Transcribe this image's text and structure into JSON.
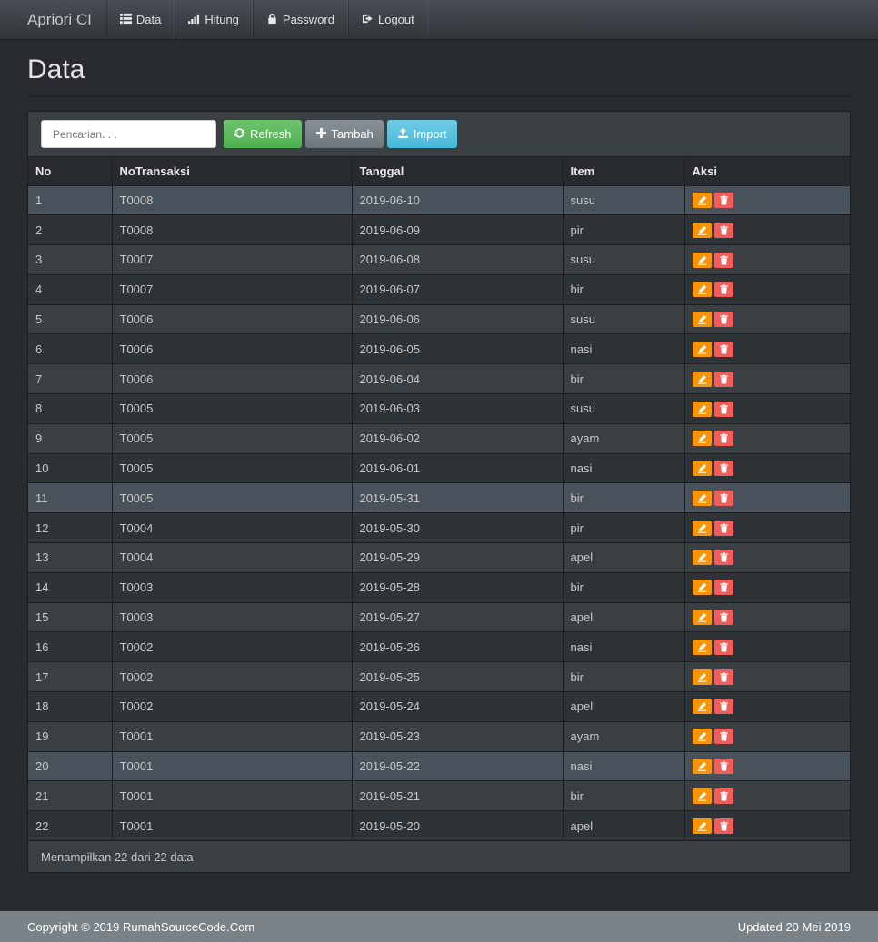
{
  "navbar": {
    "brand": "Apriori CI",
    "items": [
      {
        "label": "Data",
        "icon": "list-icon"
      },
      {
        "label": "Hitung",
        "icon": "signal-icon"
      },
      {
        "label": "Password",
        "icon": "lock-icon"
      },
      {
        "label": "Logout",
        "icon": "logout-icon"
      }
    ]
  },
  "page": {
    "title": "Data"
  },
  "toolbar": {
    "search_placeholder": "Pencarian. . .",
    "refresh_label": "Refresh",
    "add_label": "Tambah",
    "import_label": "Import"
  },
  "table": {
    "columns": [
      "No",
      "NoTransaksi",
      "Tanggal",
      "Item",
      "Aksi"
    ],
    "rows": [
      {
        "no": "1",
        "trx": "T0008",
        "date": "2019-06-10",
        "item": "susu"
      },
      {
        "no": "2",
        "trx": "T0008",
        "date": "2019-06-09",
        "item": "pir"
      },
      {
        "no": "3",
        "trx": "T0007",
        "date": "2019-06-08",
        "item": "susu"
      },
      {
        "no": "4",
        "trx": "T0007",
        "date": "2019-06-07",
        "item": "bir"
      },
      {
        "no": "5",
        "trx": "T0006",
        "date": "2019-06-06",
        "item": "susu"
      },
      {
        "no": "6",
        "trx": "T0006",
        "date": "2019-06-05",
        "item": "nasi"
      },
      {
        "no": "7",
        "trx": "T0006",
        "date": "2019-06-04",
        "item": "bir"
      },
      {
        "no": "8",
        "trx": "T0005",
        "date": "2019-06-03",
        "item": "susu"
      },
      {
        "no": "9",
        "trx": "T0005",
        "date": "2019-06-02",
        "item": "ayam"
      },
      {
        "no": "10",
        "trx": "T0005",
        "date": "2019-06-01",
        "item": "nasi"
      },
      {
        "no": "11",
        "trx": "T0005",
        "date": "2019-05-31",
        "item": "bir"
      },
      {
        "no": "12",
        "trx": "T0004",
        "date": "2019-05-30",
        "item": "pir"
      },
      {
        "no": "13",
        "trx": "T0004",
        "date": "2019-05-29",
        "item": "apel"
      },
      {
        "no": "14",
        "trx": "T0003",
        "date": "2019-05-28",
        "item": "bir"
      },
      {
        "no": "15",
        "trx": "T0003",
        "date": "2019-05-27",
        "item": "apel"
      },
      {
        "no": "16",
        "trx": "T0002",
        "date": "2019-05-26",
        "item": "nasi"
      },
      {
        "no": "17",
        "trx": "T0002",
        "date": "2019-05-25",
        "item": "bir"
      },
      {
        "no": "18",
        "trx": "T0002",
        "date": "2019-05-24",
        "item": "apel"
      },
      {
        "no": "19",
        "trx": "T0001",
        "date": "2019-05-23",
        "item": "ayam"
      },
      {
        "no": "20",
        "trx": "T0001",
        "date": "2019-05-22",
        "item": "nasi"
      },
      {
        "no": "21",
        "trx": "T0001",
        "date": "2019-05-21",
        "item": "bir"
      },
      {
        "no": "22",
        "trx": "T0001",
        "date": "2019-05-20",
        "item": "apel"
      }
    ],
    "highlighted_rows": [
      1,
      11,
      20
    ],
    "edit_icon": "edit-icon",
    "delete_icon": "trash-icon"
  },
  "panel_footer": {
    "summary": "Menampilkan 22 dari 22 data"
  },
  "footer": {
    "copyright": "Copyright © 2019 RumahSourceCode.Com",
    "updated": "Updated 20 Mei 2019"
  },
  "colors": {
    "background": "#272b30",
    "navbar": "#3a3f44",
    "success": "#5cb85c",
    "info": "#5bc0de",
    "warning": "#f89406",
    "danger": "#ee5f5b",
    "footer": "#7a8288"
  }
}
